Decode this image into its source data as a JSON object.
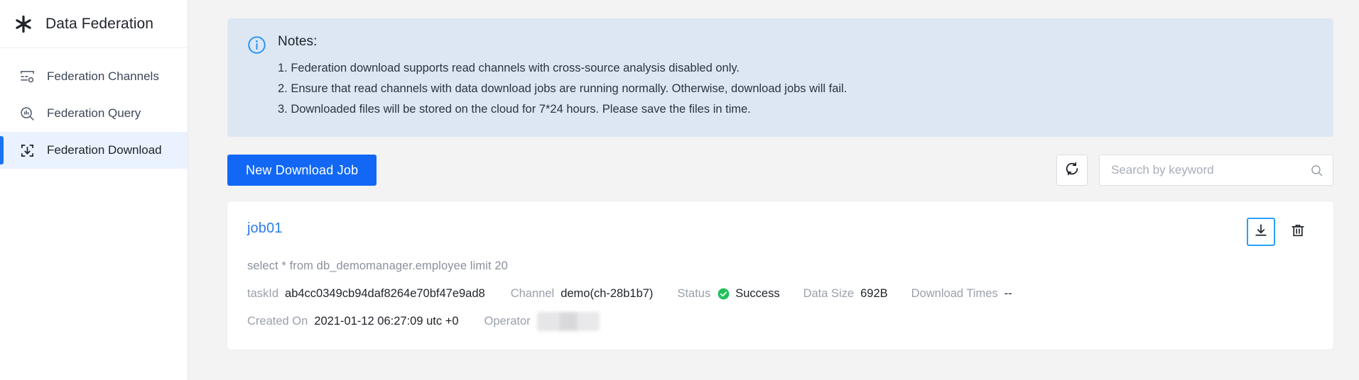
{
  "sidebar": {
    "brand_icon": "asterisk-icon",
    "title": "Data Federation",
    "items": [
      {
        "icon": "federation-channels-icon",
        "label": "Federation Channels",
        "active": false
      },
      {
        "icon": "federation-query-icon",
        "label": "Federation Query",
        "active": false
      },
      {
        "icon": "federation-download-icon",
        "label": "Federation Download",
        "active": true
      }
    ]
  },
  "notes": {
    "icon": "info-circle-icon",
    "title": "Notes:",
    "lines": [
      "1. Federation download supports read channels with cross-source analysis disabled only.",
      "2. Ensure that read channels with data download jobs are running normally. Otherwise, download jobs will fail.",
      "3. Downloaded files will be stored on the cloud for 7*24 hours. Please save the files in time."
    ],
    "background": "#dde7f4"
  },
  "toolbar": {
    "new_job_label": "New Download Job",
    "new_job_color": "#1268f5",
    "refresh_icon": "refresh-icon",
    "search": {
      "placeholder": "Search by keyword",
      "value": "",
      "icon": "search-icon"
    }
  },
  "job": {
    "name": "job01",
    "name_color": "#2b7cf0",
    "sql": "select * from db_demomanager.employee limit 20",
    "actions": [
      {
        "icon": "download-icon",
        "focused": true
      },
      {
        "icon": "trash-icon",
        "focused": false
      }
    ],
    "meta": {
      "task_id_label": "taskId",
      "task_id_value": "ab4cc0349cb94daf8264e70bf47e9ad8",
      "channel_label": "Channel",
      "channel_value": "demo(ch-28b1b7)",
      "status_label": "Status",
      "status_value": "Success",
      "status_icon": "check-circle-icon",
      "status_color": "#21c25b",
      "data_size_label": "Data Size",
      "data_size_value": "692B",
      "download_times_label": "Download Times",
      "download_times_value": "--",
      "created_on_label": "Created On",
      "created_on_value": "2021-01-12 06:27:09 utc +0",
      "operator_label": "Operator",
      "operator_value": ""
    }
  }
}
